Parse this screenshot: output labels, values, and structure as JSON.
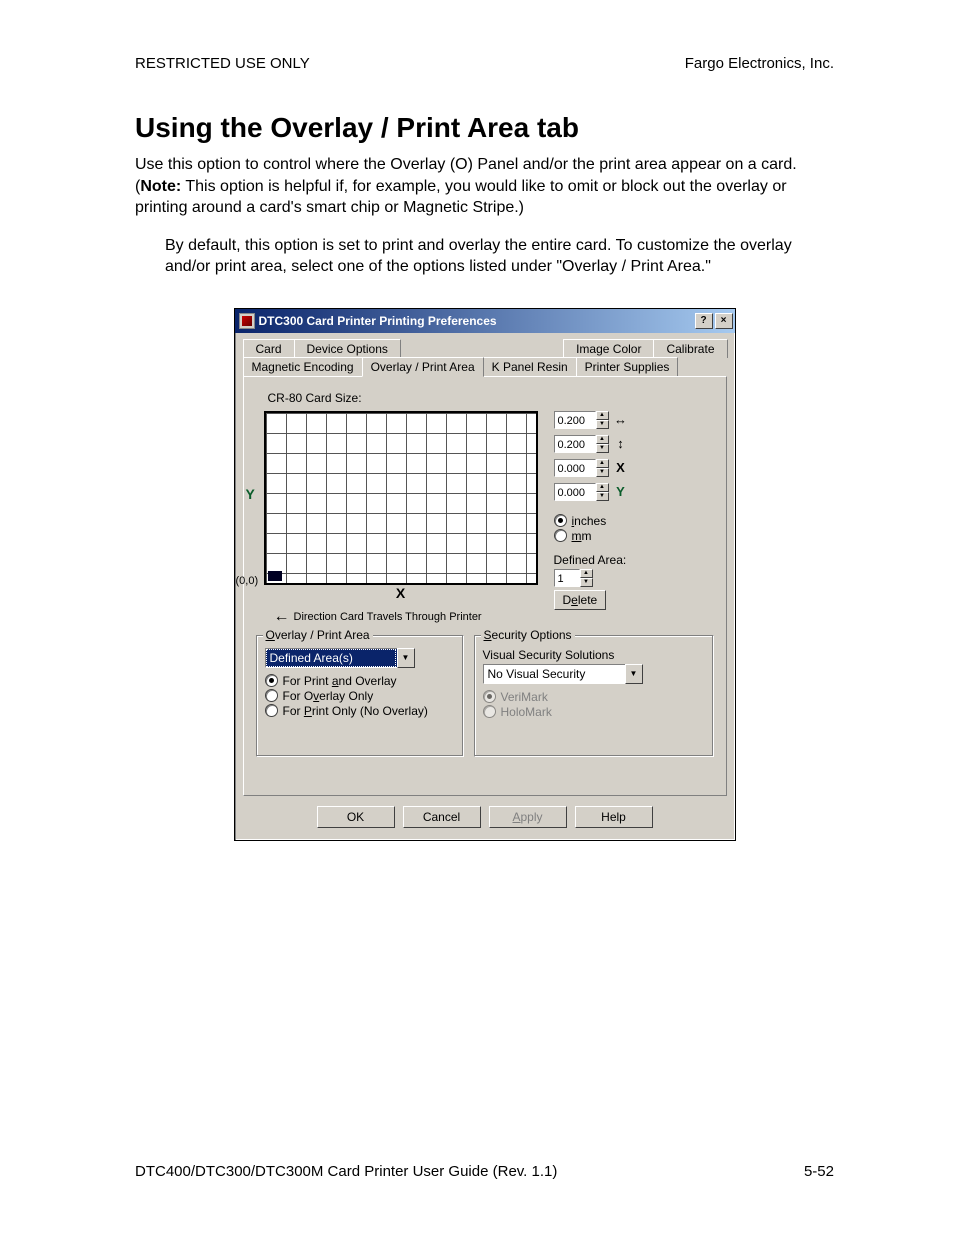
{
  "header": {
    "left": "RESTRICTED USE ONLY",
    "right": "Fargo Electronics, Inc."
  },
  "title": "Using the Overlay / Print Area tab",
  "intro_parts": {
    "p1a": "Use this option to control where the Overlay (O) Panel and/or the print area appear on a card. (",
    "note_label": "Note:",
    "p1b": "  This option is helpful if, for example, you would like to omit or block out the overlay or printing around a card's smart chip or Magnetic Stripe.)"
  },
  "indent_para": "By default, this option is set to print and overlay the entire card. To customize the overlay and/or print area, select one of the options listed under \"Overlay / Print Area.\"",
  "footer": {
    "left": "DTC400/DTC300/DTC300M Card Printer User Guide (Rev. 1.1)",
    "right": "5-52"
  },
  "dialog": {
    "title": "DTC300 Card Printer Printing Preferences",
    "help_btn": "?",
    "close_btn": "×",
    "tabs_row1": [
      "Card",
      "Device Options",
      "Image Color",
      "Calibrate"
    ],
    "tabs_row2": [
      "Magnetic Encoding",
      "Overlay / Print Area",
      "K Panel Resin",
      "Printer Supplies"
    ],
    "active_tab": "Overlay / Print Area",
    "cr80_label": "CR-80 Card Size:",
    "y_axis_label": "Y",
    "x_axis_label": "X",
    "origin_label": "(0,0)",
    "direction_label": "Direction Card Travels Through Printer",
    "dim_spinners": [
      {
        "value": "0.200",
        "icon": "↔",
        "name": "width"
      },
      {
        "value": "0.200",
        "icon": "↕",
        "name": "height"
      },
      {
        "value": "0.000",
        "icon": "X",
        "name": "x"
      },
      {
        "value": "0.000",
        "icon": "Y",
        "name": "y"
      }
    ],
    "unit_radios": {
      "inches": {
        "label": "inches",
        "checked": true
      },
      "mm": {
        "label": "mm",
        "checked": false
      }
    },
    "defined_area_label": "Defined Area:",
    "defined_area_value": "1",
    "delete_btn": "Delete",
    "overlay_group": {
      "legend": "Overlay / Print Area",
      "combo": "Defined Area(s)",
      "radios": [
        {
          "label": "For Print and Overlay",
          "checked": true
        },
        {
          "label": "For Overlay Only",
          "checked": false
        },
        {
          "label": "For Print Only (No Overlay)",
          "checked": false
        }
      ]
    },
    "security_group": {
      "legend": "Security Options",
      "vss_label": "Visual Security Solutions",
      "vss_combo": "No Visual Security",
      "radios": [
        {
          "label": "VeriMark",
          "checked": true
        },
        {
          "label": "HoloMark",
          "checked": false
        }
      ]
    },
    "buttons": {
      "ok": "OK",
      "cancel": "Cancel",
      "apply": "Apply",
      "help": "Help"
    }
  }
}
